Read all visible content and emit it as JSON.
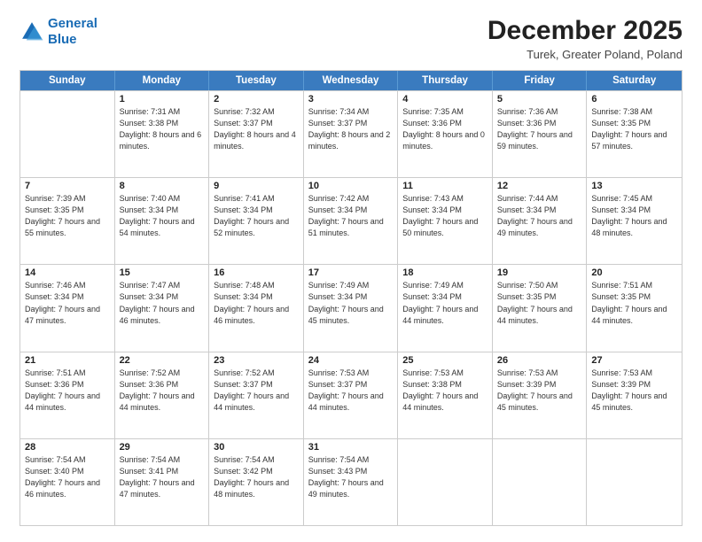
{
  "logo": {
    "line1": "General",
    "line2": "Blue"
  },
  "title": "December 2025",
  "subtitle": "Turek, Greater Poland, Poland",
  "header_days": [
    "Sunday",
    "Monday",
    "Tuesday",
    "Wednesday",
    "Thursday",
    "Friday",
    "Saturday"
  ],
  "weeks": [
    [
      {
        "date": "",
        "sunrise": "",
        "sunset": "",
        "daylight": ""
      },
      {
        "date": "1",
        "sunrise": "Sunrise: 7:31 AM",
        "sunset": "Sunset: 3:38 PM",
        "daylight": "Daylight: 8 hours and 6 minutes."
      },
      {
        "date": "2",
        "sunrise": "Sunrise: 7:32 AM",
        "sunset": "Sunset: 3:37 PM",
        "daylight": "Daylight: 8 hours and 4 minutes."
      },
      {
        "date": "3",
        "sunrise": "Sunrise: 7:34 AM",
        "sunset": "Sunset: 3:37 PM",
        "daylight": "Daylight: 8 hours and 2 minutes."
      },
      {
        "date": "4",
        "sunrise": "Sunrise: 7:35 AM",
        "sunset": "Sunset: 3:36 PM",
        "daylight": "Daylight: 8 hours and 0 minutes."
      },
      {
        "date": "5",
        "sunrise": "Sunrise: 7:36 AM",
        "sunset": "Sunset: 3:36 PM",
        "daylight": "Daylight: 7 hours and 59 minutes."
      },
      {
        "date": "6",
        "sunrise": "Sunrise: 7:38 AM",
        "sunset": "Sunset: 3:35 PM",
        "daylight": "Daylight: 7 hours and 57 minutes."
      }
    ],
    [
      {
        "date": "7",
        "sunrise": "Sunrise: 7:39 AM",
        "sunset": "Sunset: 3:35 PM",
        "daylight": "Daylight: 7 hours and 55 minutes."
      },
      {
        "date": "8",
        "sunrise": "Sunrise: 7:40 AM",
        "sunset": "Sunset: 3:34 PM",
        "daylight": "Daylight: 7 hours and 54 minutes."
      },
      {
        "date": "9",
        "sunrise": "Sunrise: 7:41 AM",
        "sunset": "Sunset: 3:34 PM",
        "daylight": "Daylight: 7 hours and 52 minutes."
      },
      {
        "date": "10",
        "sunrise": "Sunrise: 7:42 AM",
        "sunset": "Sunset: 3:34 PM",
        "daylight": "Daylight: 7 hours and 51 minutes."
      },
      {
        "date": "11",
        "sunrise": "Sunrise: 7:43 AM",
        "sunset": "Sunset: 3:34 PM",
        "daylight": "Daylight: 7 hours and 50 minutes."
      },
      {
        "date": "12",
        "sunrise": "Sunrise: 7:44 AM",
        "sunset": "Sunset: 3:34 PM",
        "daylight": "Daylight: 7 hours and 49 minutes."
      },
      {
        "date": "13",
        "sunrise": "Sunrise: 7:45 AM",
        "sunset": "Sunset: 3:34 PM",
        "daylight": "Daylight: 7 hours and 48 minutes."
      }
    ],
    [
      {
        "date": "14",
        "sunrise": "Sunrise: 7:46 AM",
        "sunset": "Sunset: 3:34 PM",
        "daylight": "Daylight: 7 hours and 47 minutes."
      },
      {
        "date": "15",
        "sunrise": "Sunrise: 7:47 AM",
        "sunset": "Sunset: 3:34 PM",
        "daylight": "Daylight: 7 hours and 46 minutes."
      },
      {
        "date": "16",
        "sunrise": "Sunrise: 7:48 AM",
        "sunset": "Sunset: 3:34 PM",
        "daylight": "Daylight: 7 hours and 46 minutes."
      },
      {
        "date": "17",
        "sunrise": "Sunrise: 7:49 AM",
        "sunset": "Sunset: 3:34 PM",
        "daylight": "Daylight: 7 hours and 45 minutes."
      },
      {
        "date": "18",
        "sunrise": "Sunrise: 7:49 AM",
        "sunset": "Sunset: 3:34 PM",
        "daylight": "Daylight: 7 hours and 44 minutes."
      },
      {
        "date": "19",
        "sunrise": "Sunrise: 7:50 AM",
        "sunset": "Sunset: 3:35 PM",
        "daylight": "Daylight: 7 hours and 44 minutes."
      },
      {
        "date": "20",
        "sunrise": "Sunrise: 7:51 AM",
        "sunset": "Sunset: 3:35 PM",
        "daylight": "Daylight: 7 hours and 44 minutes."
      }
    ],
    [
      {
        "date": "21",
        "sunrise": "Sunrise: 7:51 AM",
        "sunset": "Sunset: 3:36 PM",
        "daylight": "Daylight: 7 hours and 44 minutes."
      },
      {
        "date": "22",
        "sunrise": "Sunrise: 7:52 AM",
        "sunset": "Sunset: 3:36 PM",
        "daylight": "Daylight: 7 hours and 44 minutes."
      },
      {
        "date": "23",
        "sunrise": "Sunrise: 7:52 AM",
        "sunset": "Sunset: 3:37 PM",
        "daylight": "Daylight: 7 hours and 44 minutes."
      },
      {
        "date": "24",
        "sunrise": "Sunrise: 7:53 AM",
        "sunset": "Sunset: 3:37 PM",
        "daylight": "Daylight: 7 hours and 44 minutes."
      },
      {
        "date": "25",
        "sunrise": "Sunrise: 7:53 AM",
        "sunset": "Sunset: 3:38 PM",
        "daylight": "Daylight: 7 hours and 44 minutes."
      },
      {
        "date": "26",
        "sunrise": "Sunrise: 7:53 AM",
        "sunset": "Sunset: 3:39 PM",
        "daylight": "Daylight: 7 hours and 45 minutes."
      },
      {
        "date": "27",
        "sunrise": "Sunrise: 7:53 AM",
        "sunset": "Sunset: 3:39 PM",
        "daylight": "Daylight: 7 hours and 45 minutes."
      }
    ],
    [
      {
        "date": "28",
        "sunrise": "Sunrise: 7:54 AM",
        "sunset": "Sunset: 3:40 PM",
        "daylight": "Daylight: 7 hours and 46 minutes."
      },
      {
        "date": "29",
        "sunrise": "Sunrise: 7:54 AM",
        "sunset": "Sunset: 3:41 PM",
        "daylight": "Daylight: 7 hours and 47 minutes."
      },
      {
        "date": "30",
        "sunrise": "Sunrise: 7:54 AM",
        "sunset": "Sunset: 3:42 PM",
        "daylight": "Daylight: 7 hours and 48 minutes."
      },
      {
        "date": "31",
        "sunrise": "Sunrise: 7:54 AM",
        "sunset": "Sunset: 3:43 PM",
        "daylight": "Daylight: 7 hours and 49 minutes."
      },
      {
        "date": "",
        "sunrise": "",
        "sunset": "",
        "daylight": ""
      },
      {
        "date": "",
        "sunrise": "",
        "sunset": "",
        "daylight": ""
      },
      {
        "date": "",
        "sunrise": "",
        "sunset": "",
        "daylight": ""
      }
    ]
  ]
}
